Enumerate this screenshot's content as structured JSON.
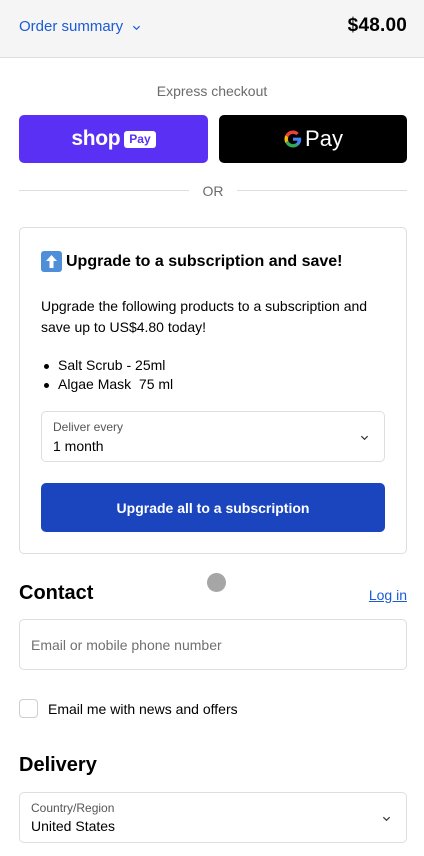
{
  "order_summary": {
    "toggle_label": "Order summary",
    "total": "$48.00"
  },
  "express_checkout": {
    "title": "Express checkout",
    "shop_pay": {
      "word": "shop",
      "chip": "Pay"
    },
    "google_pay": {
      "word": "Pay"
    },
    "divider_text": "OR"
  },
  "upsell": {
    "title": "Upgrade to a subscription and save!",
    "description": "Upgrade the following products to a subscription and save up to US$4.80 today!",
    "items": [
      "Salt Scrub - 25ml",
      "Algae Mask  75 ml"
    ],
    "deliver_label": "Deliver every",
    "deliver_value": "1 month",
    "button_label": "Upgrade all to a subscription"
  },
  "contact": {
    "title": "Contact",
    "login_label": "Log in",
    "email_placeholder": "Email or mobile phone number",
    "newsletter_label": "Email me with news and offers"
  },
  "delivery": {
    "title": "Delivery",
    "country_label": "Country/Region",
    "country_value": "United States"
  },
  "colors": {
    "link": "#1a5bd6",
    "shop_pay": "#5a31f4",
    "primary_button": "#1a45bf"
  },
  "icons": {
    "summary_chevron": "chevron-down-icon",
    "google_logo": "google-g-icon",
    "upgrade_arrow": "up-arrow-emoji-icon",
    "select_chevron": "chevron-down-icon"
  }
}
